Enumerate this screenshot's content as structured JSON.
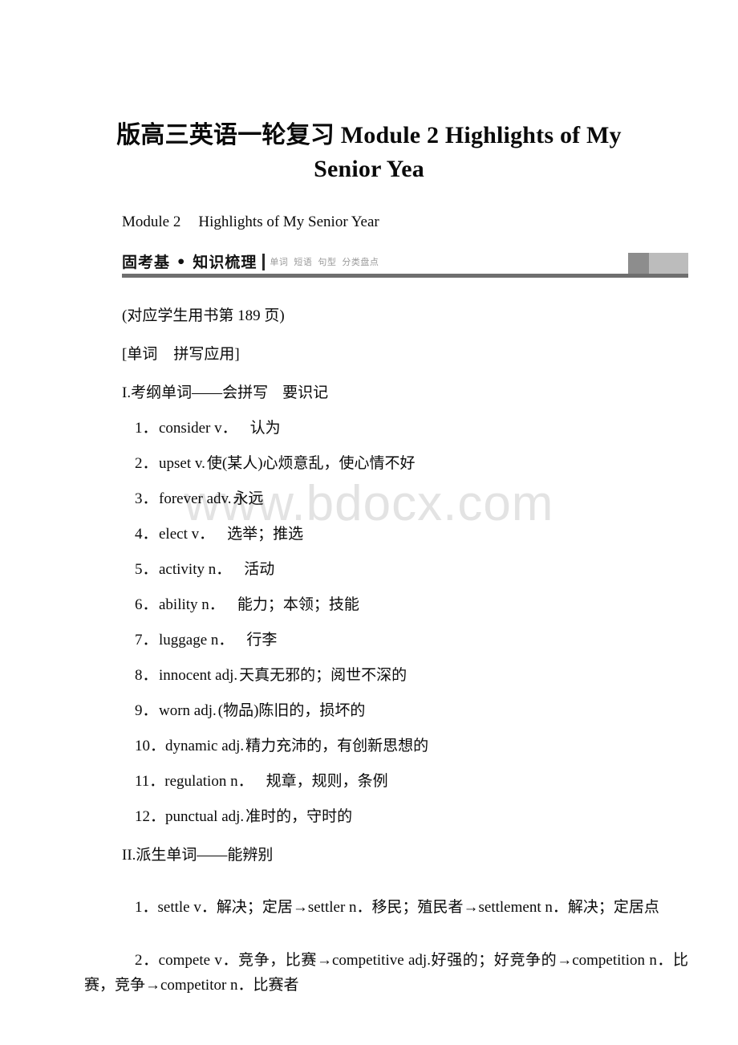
{
  "document": {
    "title": "版高三英语一轮复习 Module 2 Highlights of My Senior Yea",
    "module_label": "Module 2",
    "module_name": "Highlights of My Senior Year",
    "watermark": "www.bdocx.com"
  },
  "banner": {
    "title": "固考基 • 知识梳理",
    "tags": [
      "单词",
      "短语",
      "句型",
      "分类盘点"
    ],
    "box_dark_color": "#8d8d8d",
    "box_light_color": "#bcbcbc",
    "rule_color": "#6f6f6f"
  },
  "book_reference": "(对应学生用书第 189 页)",
  "section_label": "[单词",
  "section_label_2": "拼写应用]",
  "sections": [
    {
      "roman": "I.考纲单词——会拼写",
      "roman_suffix": "要识记",
      "items": [
        {
          "num": "1．",
          "word": "consider v．",
          "gap": true,
          "meaning": "认为"
        },
        {
          "num": "2．",
          "word": "upset v.",
          "gap": false,
          "meaning": "使(某人)心烦意乱，使心情不好"
        },
        {
          "num": "3．",
          "word": "forever adv.",
          "gap": false,
          "meaning": "永远"
        },
        {
          "num": "4．",
          "word": "elect v．",
          "gap": true,
          "meaning": "选举；推选"
        },
        {
          "num": "5．",
          "word": "activity n．",
          "gap": true,
          "meaning": "活动"
        },
        {
          "num": "6．",
          "word": "ability n．",
          "gap": true,
          "meaning": "能力；本领；技能"
        },
        {
          "num": "7．",
          "word": "luggage n．",
          "gap": true,
          "meaning": "行李"
        },
        {
          "num": "8．",
          "word": "innocent adj.",
          "gap": false,
          "meaning": "天真无邪的；阅世不深的"
        },
        {
          "num": "9．",
          "word": "worn adj.",
          "gap": false,
          "meaning": "(物品)陈旧的，损坏的"
        },
        {
          "num": "10．",
          "word": "dynamic adj.",
          "gap": false,
          "meaning": "精力充沛的，有创新思想的"
        },
        {
          "num": "11．",
          "word": "regulation n．",
          "gap": true,
          "meaning": "规章，规则，条例"
        },
        {
          "num": "12．",
          "word": "punctual adj.",
          "gap": false,
          "meaning": "准时的，守时的"
        }
      ]
    }
  ],
  "derived_section": {
    "roman": "II.派生单词——能辨别",
    "items": [
      "1．settle v．解决；定居→settler n．移民；殖民者→settlement n．解决；定居点",
      "2．compete v．竞争，比赛→competitive adj.好强的；好竞争的→competition n．比赛，竞争→competitor n．比赛者"
    ]
  }
}
